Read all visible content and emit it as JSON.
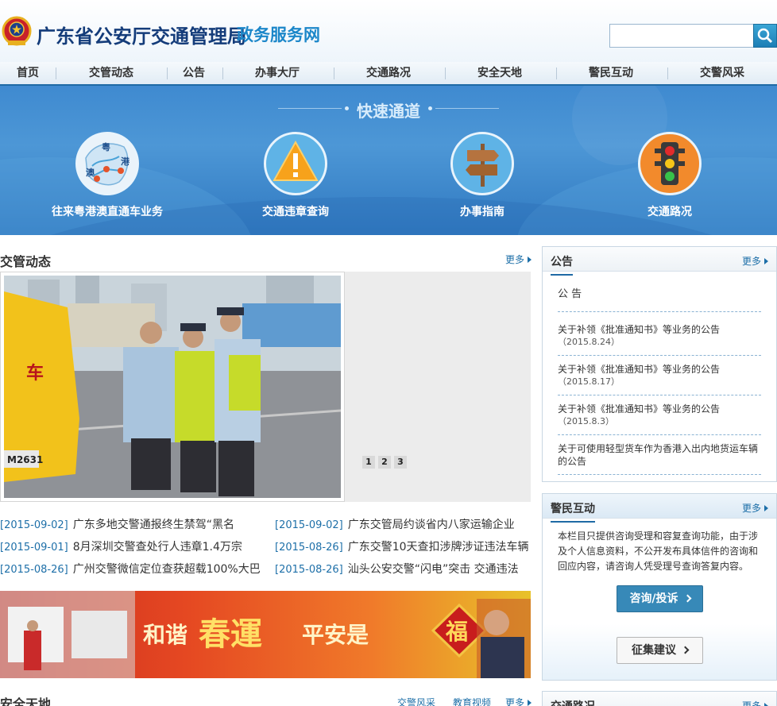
{
  "header": {
    "title": "广东省公安厅交通管理局",
    "subtitle": "政务服务网",
    "search_placeholder": ""
  },
  "nav": [
    "首页",
    "交管动态",
    "公告",
    "办事大厅",
    "交通路况",
    "安全天地",
    "警民互动",
    "交警风采"
  ],
  "quick": {
    "title": "快速通道",
    "items": [
      {
        "label": "往来粤港澳直通车业务",
        "map_labels": [
          "粤",
          "港",
          "澳"
        ]
      },
      {
        "label": "交通违章查询"
      },
      {
        "label": "办事指南"
      },
      {
        "label": "交通路况"
      }
    ]
  },
  "news_section": {
    "title": "交管动态",
    "more": "更多",
    "slide_pages": [
      "1",
      "2",
      "3"
    ],
    "slide_photo_text": {
      "bus_word": "车",
      "plate": "M2631"
    },
    "items": [
      {
        "date": "[2015-09-02]",
        "text": "广东多地交警通报终生禁驾“黑名"
      },
      {
        "date": "[2015-09-02]",
        "text": "广东交管局约谈省内八家运输企业"
      },
      {
        "date": "[2015-09-01]",
        "text": "8月深圳交警查处行人违章1.4万宗"
      },
      {
        "date": "[2015-08-26]",
        "text": "广东交警10天查扣涉牌涉证违法车辆"
      },
      {
        "date": "[2015-08-26]",
        "text": "广州交警微信定位查获超载100%大巴"
      },
      {
        "date": "[2015-08-26]",
        "text": "汕头公安交警“闪电”突击 交通违法"
      }
    ]
  },
  "banner": {
    "text1": "和谐",
    "text2": "春運",
    "text3": "平安是",
    "fu": "福"
  },
  "safety_section": {
    "title": "安全天地",
    "tabs": [
      "交警风采",
      "教育视频"
    ],
    "more": "更多"
  },
  "notice_panel": {
    "title": "公告",
    "more": "更多",
    "heading": "公 告",
    "items": [
      {
        "text": "关于补领《批准通知书》等业务的公告",
        "date": "（2015.8.24）"
      },
      {
        "text": "关于补领《批准通知书》等业务的公告",
        "date": "（2015.8.17）"
      },
      {
        "text": "关于补领《批准通知书》等业务的公告",
        "date": "（2015.8.3）"
      },
      {
        "text": "关于可使用轻型货车作为香港入出内地货运车辆的公告",
        "date": ""
      }
    ]
  },
  "interact_panel": {
    "title": "警民互动",
    "more": "更多",
    "description": "本栏目只提供咨询受理和容复查询功能，由于涉及个人信息资料，不公开发布具体信件的咨询和回应内容，请咨询人凭受理号查询答复内容。",
    "consult_label": "咨询/投诉",
    "suggest_label": "征集建议"
  },
  "traffic_panel": {
    "title": "交通路况",
    "more": "更多"
  },
  "colors": {
    "brand_navy": "#143c7a",
    "brand_blue": "#1c87c9",
    "quick_bg": "#3f8ad0",
    "link": "#1d6fa8"
  }
}
